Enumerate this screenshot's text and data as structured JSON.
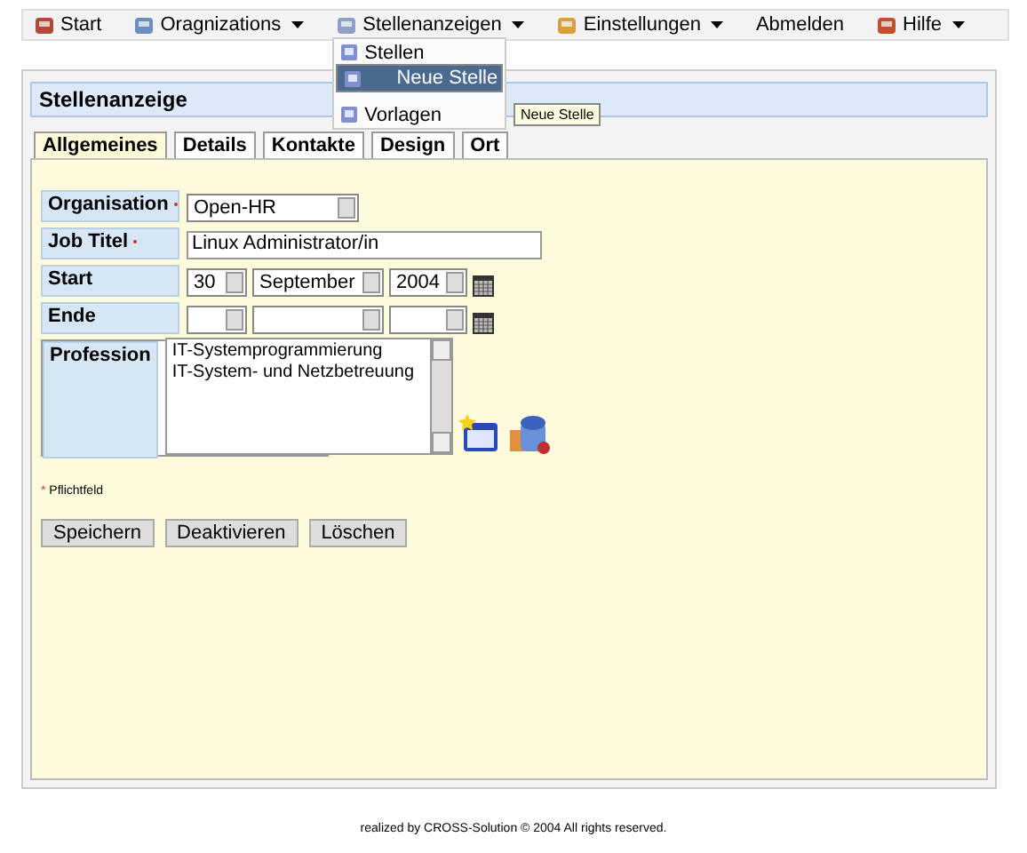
{
  "menu": [
    {
      "label": "Start",
      "icon": true,
      "caret": false,
      "open": false
    },
    {
      "label": "Oragnizations",
      "icon": true,
      "caret": true,
      "open": false
    },
    {
      "label": "Stellenanzeigen",
      "icon": true,
      "caret": true,
      "open": true
    },
    {
      "label": "Einstellungen",
      "icon": true,
      "caret": true,
      "open": false
    },
    {
      "label": "Abmelden",
      "icon": false,
      "caret": false,
      "open": false
    },
    {
      "label": "Hilfe",
      "icon": true,
      "caret": true,
      "open": false
    }
  ],
  "dropdown": {
    "items": [
      {
        "label": "Stellen",
        "selected": false
      },
      {
        "label": "Neue Stelle",
        "selected": true
      },
      {
        "label": "Vorlagen",
        "selected": false
      }
    ],
    "tooltip": "Neue Stelle"
  },
  "panel": {
    "title": "Stellenanzeige"
  },
  "tabs": [
    {
      "label": "Allgemeines",
      "selected": true
    },
    {
      "label": "Details",
      "selected": false
    },
    {
      "label": "Kontakte",
      "selected": false
    },
    {
      "label": "Design",
      "selected": false
    },
    {
      "label": "Ort",
      "selected": false
    }
  ],
  "form": [
    {
      "kind": "select",
      "label": "Organisation",
      "required": true,
      "value": "Open-HR"
    },
    {
      "kind": "text",
      "label": "Job Titel",
      "required": true,
      "value": "Linux Administrator/in"
    },
    {
      "kind": "date",
      "label": "Start",
      "required": false,
      "day": "30",
      "month": "September",
      "year": "2004"
    },
    {
      "kind": "date",
      "label": "Ende",
      "required": false
    },
    {
      "kind": "list",
      "label": "Profession",
      "required": false,
      "items": [
        "IT-Systemprogrammierung",
        "IT-System- und Netzbetreuung"
      ]
    }
  ],
  "note": {
    "mark": "*",
    "text": "Pflichtfeld"
  },
  "buttons": [
    "Speichern",
    "Deaktivieren",
    "Löschen"
  ],
  "footer": "realized by CROSS-Solution © 2004 All rights reserved."
}
